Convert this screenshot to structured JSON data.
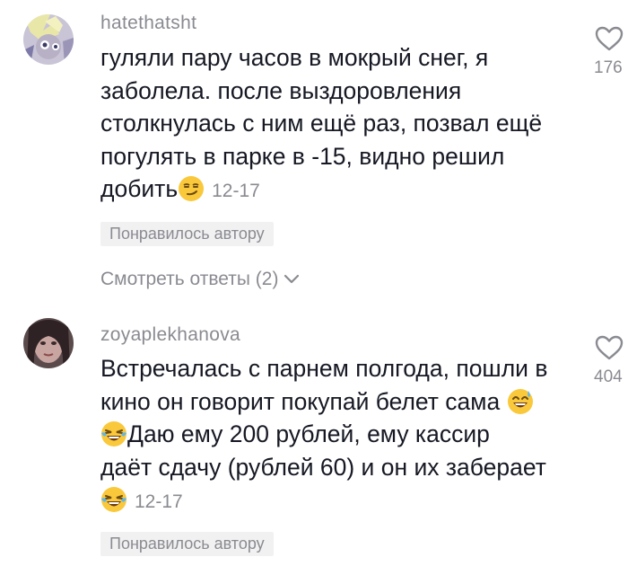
{
  "comments": [
    {
      "username": "hatethatsht",
      "lines": [
        "гуляли пару часов в мокрый снег, я",
        "заболела. после выздоровления",
        "столкнулась с ним ещё раз, позвал ещё",
        "погулять в парке в -15, видно решил",
        "добить"
      ],
      "emoji": "smirk-emoji",
      "date": "12-17",
      "liked_badge": "Понравилось автору",
      "replies": "Смотреть ответы (2)",
      "like_count": "176"
    },
    {
      "username": "zoyaplekhanova",
      "lines": [
        "Встречалась с парнем полгода, пошли в",
        "кино он говорит покупай белет сама",
        "Даю ему 200 рублей, ему кассир",
        "даёт сдачу (рублей 60) и он их заберает"
      ],
      "emoji": "laughing-crying-emoji",
      "date": "12-17",
      "liked_badge": "Понравилось автору",
      "like_count": "404"
    }
  ],
  "colors": {
    "text": "#161823",
    "secondary": "#8a8b91",
    "badge_bg": "#f1f1f2"
  }
}
